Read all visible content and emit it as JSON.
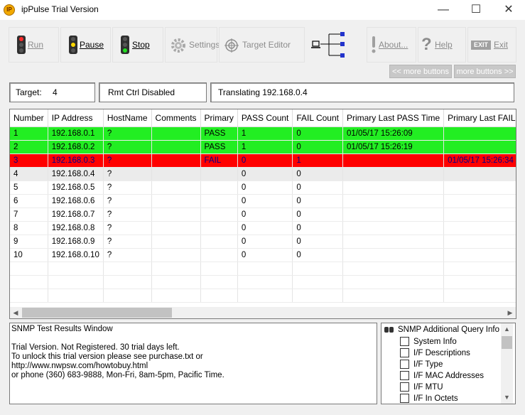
{
  "window": {
    "title": "ipPulse Trial Version",
    "app_icon_text": "IP",
    "minimize_glyph": "—",
    "maximize_glyph": "☐",
    "close_glyph": "✕"
  },
  "toolbar": {
    "run_label": "Run",
    "pause_label": "Pause",
    "stop_label": "Stop",
    "settings_label": "Settings",
    "target_editor_label": "Target Editor",
    "about_label": "About...",
    "help_label": "Help",
    "exit_label": "Exit",
    "exit_icon_text": "EXIT",
    "more_left_label": "<< more buttons",
    "more_right_label": "more buttons >>",
    "icons": {
      "run": "traffic-light-red",
      "pause": "traffic-light-yellow",
      "stop": "traffic-light-green",
      "settings": "gear",
      "target_editor": "target-crosshair",
      "network": "network-tree",
      "about": "exclamation",
      "help": "question-mark",
      "exit": "exit-sign"
    }
  },
  "status": {
    "target_label": "Target:",
    "target_value": "4",
    "remote_control": "Rmt Ctrl Disabled",
    "translating": "Translating 192.168.0.4"
  },
  "grid": {
    "columns": [
      "Number",
      "IP Address",
      "HostName",
      "Comments",
      "Primary",
      "PASS Count",
      "FAIL Count",
      "Primary Last PASS Time",
      "Primary Last FAIL Time"
    ],
    "rows": [
      {
        "number": "1",
        "ip": "192.168.0.1",
        "host": "?",
        "comments": "",
        "primary": "PASS",
        "pass": "1",
        "fail": "0",
        "last_pass": "01/05/17 15:26:09",
        "last_fail": "",
        "state": "pass"
      },
      {
        "number": "2",
        "ip": "192.168.0.2",
        "host": "?",
        "comments": "",
        "primary": "PASS",
        "pass": "1",
        "fail": "0",
        "last_pass": "01/05/17 15:26:19",
        "last_fail": "",
        "state": "pass"
      },
      {
        "number": "3",
        "ip": "192.168.0.3",
        "host": "?",
        "comments": "",
        "primary": "FAIL",
        "pass": "0",
        "fail": "1",
        "last_pass": "",
        "last_fail": "01/05/17 15:26:34",
        "state": "fail"
      },
      {
        "number": "4",
        "ip": "192.168.0.4",
        "host": "?",
        "comments": "",
        "primary": "",
        "pass": "0",
        "fail": "0",
        "last_pass": "",
        "last_fail": "",
        "state": "sel"
      },
      {
        "number": "5",
        "ip": "192.168.0.5",
        "host": "?",
        "comments": "",
        "primary": "",
        "pass": "0",
        "fail": "0",
        "last_pass": "",
        "last_fail": "",
        "state": ""
      },
      {
        "number": "6",
        "ip": "192.168.0.6",
        "host": "?",
        "comments": "",
        "primary": "",
        "pass": "0",
        "fail": "0",
        "last_pass": "",
        "last_fail": "",
        "state": ""
      },
      {
        "number": "7",
        "ip": "192.168.0.7",
        "host": "?",
        "comments": "",
        "primary": "",
        "pass": "0",
        "fail": "0",
        "last_pass": "",
        "last_fail": "",
        "state": ""
      },
      {
        "number": "8",
        "ip": "192.168.0.8",
        "host": "?",
        "comments": "",
        "primary": "",
        "pass": "0",
        "fail": "0",
        "last_pass": "",
        "last_fail": "",
        "state": ""
      },
      {
        "number": "9",
        "ip": "192.168.0.9",
        "host": "?",
        "comments": "",
        "primary": "",
        "pass": "0",
        "fail": "0",
        "last_pass": "",
        "last_fail": "",
        "state": ""
      },
      {
        "number": "10",
        "ip": "192.168.0.10",
        "host": "?",
        "comments": "",
        "primary": "",
        "pass": "0",
        "fail": "0",
        "last_pass": "",
        "last_fail": "",
        "state": ""
      },
      {
        "number": "",
        "ip": "",
        "host": "",
        "comments": "",
        "primary": "",
        "pass": "",
        "fail": "",
        "last_pass": "",
        "last_fail": "",
        "state": ""
      },
      {
        "number": "",
        "ip": "",
        "host": "",
        "comments": "",
        "primary": "",
        "pass": "",
        "fail": "",
        "last_pass": "",
        "last_fail": "",
        "state": ""
      },
      {
        "number": "",
        "ip": "",
        "host": "",
        "comments": "",
        "primary": "",
        "pass": "",
        "fail": "",
        "last_pass": "",
        "last_fail": "",
        "state": ""
      }
    ],
    "scroll_left_glyph": "◀",
    "scroll_right_glyph": "▶"
  },
  "snmp_results": {
    "lines": [
      "SNMP Test Results Window",
      "",
      "Trial Version.  Not Registered.  30 trial days left.",
      "To unlock this trial version please see purchase.txt or",
      "http://www.nwpsw.com/howtobuy.html",
      "or phone (360) 683-9888, Mon-Fri, 8am-5pm, Pacific Time."
    ]
  },
  "snmp_query": {
    "title": "SNMP Additional Query Info",
    "items": [
      "System Info",
      "I/F Descriptions",
      "I/F Type",
      "I/F MAC Addresses",
      "I/F MTU",
      "I/F In Octets"
    ],
    "scroll_up_glyph": "▲",
    "scroll_down_glyph": "▼"
  },
  "colors": {
    "pass_row": "#22ee22",
    "fail_row": "#ff0000",
    "fail_text": "#00008b",
    "selected_row": "#ebebeb"
  }
}
